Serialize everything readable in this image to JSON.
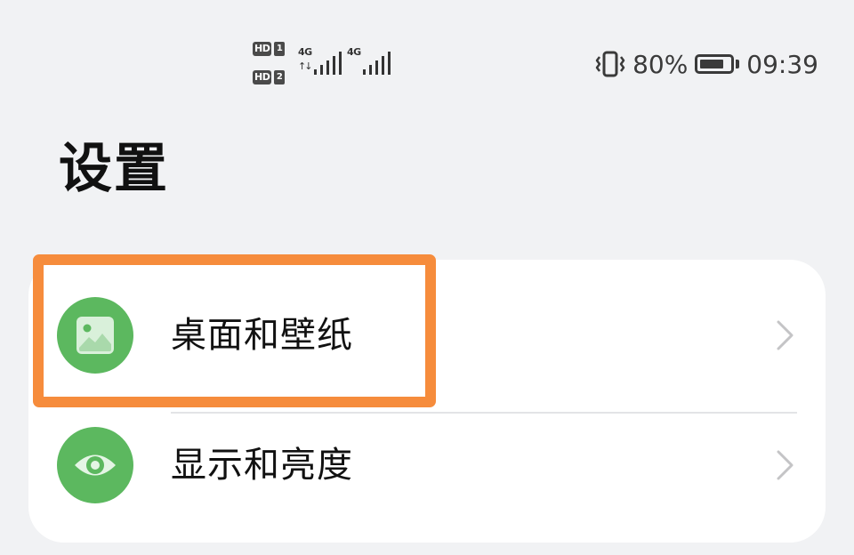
{
  "status_bar": {
    "sim1_badge": "HD",
    "sim1_number": "1",
    "sim2_badge": "HD",
    "sim2_number": "2",
    "sim1_network": "4G",
    "sim2_network": "4G",
    "battery_percent": "80%",
    "battery_level": 0.8,
    "time": "09:39",
    "icons": [
      "vibrate-icon",
      "battery-icon",
      "signal-icon"
    ]
  },
  "page": {
    "title": "设置"
  },
  "settings": {
    "items": [
      {
        "label": "桌面和壁纸",
        "icon": "wallpaper-icon",
        "icon_color": "#5cb85f"
      },
      {
        "label": "显示和亮度",
        "icon": "eye-icon",
        "icon_color": "#5cb85f"
      }
    ]
  },
  "highlight": {
    "color": "#f68c3c",
    "target": "桌面和壁纸"
  }
}
